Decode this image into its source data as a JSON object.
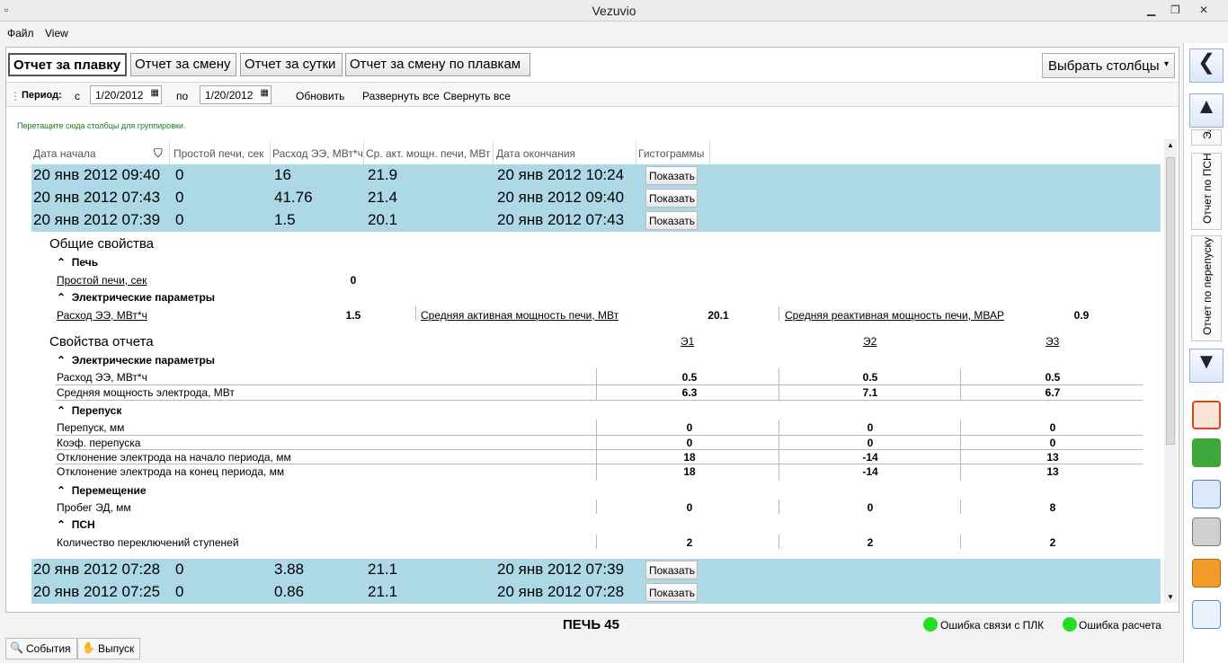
{
  "window": {
    "title": "Vezuvio"
  },
  "menu": [
    "Файл",
    "View"
  ],
  "report_tabs": [
    "Отчет за плавку",
    "Отчет за смену",
    "Отчет за сутки",
    "Отчет за смену по плавкам"
  ],
  "choose_columns": "Выбрать столбцы",
  "period": {
    "label": "Период:",
    "from_label": "с",
    "from": "1/20/2012",
    "to_label": "по",
    "to": "1/20/2012",
    "refresh": "Обновить",
    "expand_all": "Развернуть все",
    "collapse_all": "Свернуть все"
  },
  "group_hint": "Перетащите сюда столбцы для группировки.",
  "columns": [
    "Дата начала",
    "Простой печи, сек",
    "Расход ЭЭ, МВт*ч",
    "Ср. акт. мощн. печи, МВт",
    "Дата окончания",
    "Гистограммы"
  ],
  "rows_top": [
    {
      "start": "20 янв 2012 09:40",
      "idle": "0",
      "energy": "16",
      "power": "21.9",
      "end": "20 янв 2012 10:24",
      "btn": "Показать"
    },
    {
      "start": "20 янв 2012 07:43",
      "idle": "0",
      "energy": "41.76",
      "power": "21.4",
      "end": "20 янв 2012 09:40",
      "btn": "Показать"
    },
    {
      "start": "20 янв 2012 07:39",
      "idle": "0",
      "energy": "1.5",
      "power": "20.1",
      "end": "20 янв 2012 07:43",
      "btn": "Показать"
    }
  ],
  "details": {
    "general_title": "Общие свойства",
    "furnace_group": "Печь",
    "idle_label": "Простой печи, сек",
    "idle_value": "0",
    "elec_group": "Электрические параметры",
    "energy_label": "Расход ЭЭ, МВт*ч",
    "energy_value": "1.5",
    "avg_active_label": "Средняя активная мощность печи, МВт",
    "avg_active_value": "20.1",
    "avg_reactive_label": "Средняя реактивная мощность печи, МВАР",
    "avg_reactive_value": "0.9",
    "report_title": "Свойства отчета",
    "electrodes": [
      "Э1",
      "Э2",
      "Э3"
    ],
    "groups": [
      {
        "name": "Электрические параметры",
        "rows": [
          {
            "label": "Расход ЭЭ, МВт*ч",
            "values": [
              "0.5",
              "0.5",
              "0.5"
            ]
          },
          {
            "label": "Средняя мощность электрода, МВт",
            "values": [
              "6.3",
              "7.1",
              "6.7"
            ]
          }
        ]
      },
      {
        "name": "Перепуск",
        "rows": [
          {
            "label": "Перепуск, мм",
            "values": [
              "0",
              "0",
              "0"
            ]
          },
          {
            "label": "Коэф. перепуска",
            "values": [
              "0",
              "0",
              "0"
            ]
          },
          {
            "label": "Отклонение электрода на начало периода, мм",
            "values": [
              "18",
              "-14",
              "13"
            ]
          },
          {
            "label": "Отклонение электрода на конец периода, мм",
            "values": [
              "18",
              "-14",
              "13"
            ]
          }
        ]
      },
      {
        "name": "Перемещение",
        "rows": [
          {
            "label": "Пробег ЭД, мм",
            "values": [
              "0",
              "0",
              "8"
            ]
          }
        ]
      },
      {
        "name": "ПСН",
        "rows": [
          {
            "label": "Количество переключений ступеней",
            "values": [
              "2",
              "2",
              "2"
            ]
          }
        ]
      }
    ]
  },
  "rows_bottom": [
    {
      "start": "20 янв 2012 07:28",
      "idle": "0",
      "energy": "3.88",
      "power": "21.1",
      "end": "20 янв 2012 07:39",
      "btn": "Показать"
    },
    {
      "start": "20 янв 2012 07:25",
      "idle": "0",
      "energy": "0.86",
      "power": "21.1",
      "end": "20 янв 2012 07:28",
      "btn": "Показать"
    }
  ],
  "status": {
    "furnace": "ПЕЧЬ 45",
    "plc_error": "Ошибка связи с ПЛК",
    "calc_error": "Ошибка расчета",
    "indicator_color": "#22dd22"
  },
  "bottom_tabs": [
    "События",
    "Выпуск"
  ],
  "right_tabs": [
    "Эл",
    "Отчет по ПСН",
    "Отчет по перепуску"
  ],
  "right_icons": [
    "cube-icon",
    "blocks-icon",
    "network-icon",
    "scale-icon",
    "calendar-icon",
    "chart-icon"
  ]
}
